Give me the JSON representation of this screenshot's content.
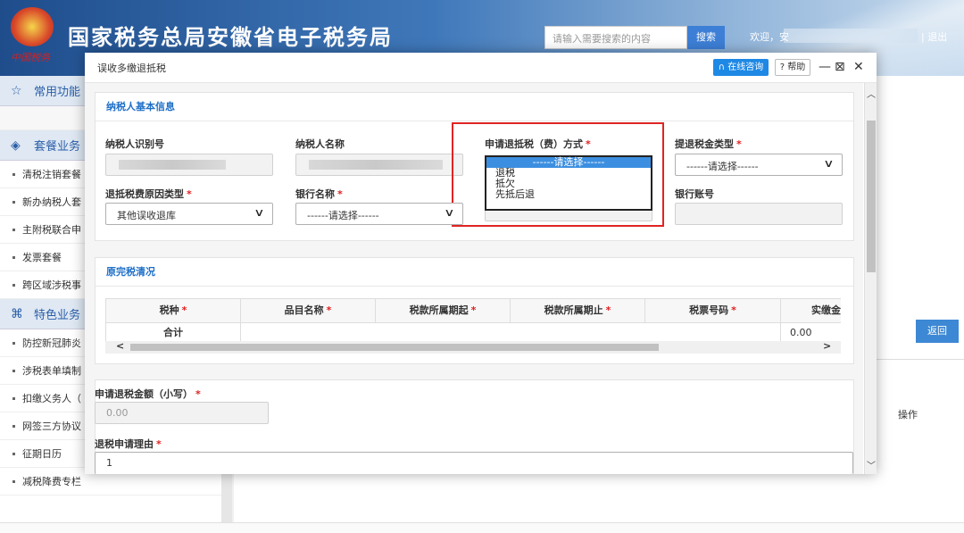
{
  "header": {
    "emblem_text": "中国税务",
    "title": "国家税务总局安徽省电子税务局",
    "search_placeholder": "请输入需要搜索的内容",
    "search_btn": "搜索",
    "welcome": "欢迎，安",
    "logout": "| 退出"
  },
  "sidebar": {
    "common": "常用功能",
    "package": "套餐业务",
    "package_items": [
      "清税注销套餐",
      "新办纳税人套",
      "主附税联合申",
      "发票套餐",
      "跨区域涉税事"
    ],
    "special": "特色业务",
    "special_items": [
      "防控新冠肺炎",
      "涉税表单填制",
      "扣缴义务人（",
      "网签三方协议",
      "征期日历",
      "减税降费专栏"
    ]
  },
  "background": {
    "return_btn": "返回",
    "op_col": "操作"
  },
  "modal": {
    "title": "误收多缴退抵税",
    "consult": "在线咨询",
    "help": "帮助",
    "minimize": "—",
    "maximize": "⊠",
    "close": "✕",
    "section1": {
      "title": "纳税人基本信息",
      "taxpayer_id": "纳税人识别号",
      "taxpayer_name": "纳税人名称",
      "refund_method": "申请退抵税（费）方式",
      "refund_method_options": [
        "------请选择------",
        "退税",
        "抵欠",
        "先抵后退"
      ],
      "refund_tax_type": "提退税金类型",
      "refund_tax_type_value": "------请选择------",
      "reason_type": "退抵税费原因类型",
      "reason_value": "其他误收退库",
      "bank_name": "银行名称",
      "bank_value": "------请选择------",
      "bank_account": "银行账号"
    },
    "section2": {
      "title": "原完税清况",
      "columns": [
        "税种",
        "品目名称",
        "税款所属期起",
        "税款所属期止",
        "税票号码",
        "实缴金"
      ],
      "required_columns": [
        true,
        true,
        true,
        true,
        true,
        false
      ],
      "total_label": "合计",
      "total_value": "0.00"
    },
    "section3": {
      "amount_label": "申请退税金额（小写）",
      "amount_value": "0.00",
      "reason_label": "退税申请理由",
      "reason_value": "1"
    }
  }
}
